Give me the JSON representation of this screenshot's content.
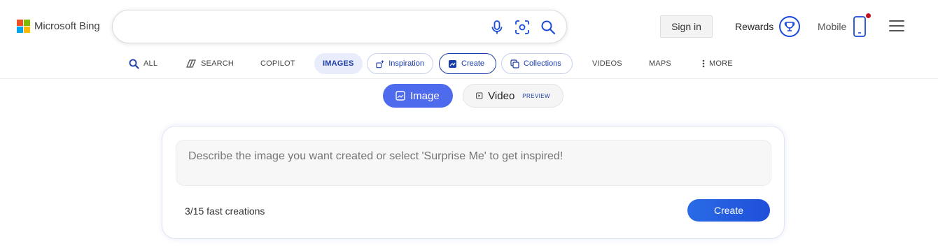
{
  "header": {
    "logo_text": "Microsoft Bing",
    "logo_colors": [
      "#f25022",
      "#7fba00",
      "#00a4ef",
      "#ffb900"
    ],
    "search": {
      "value": "",
      "placeholder": "",
      "icons": [
        "microphone-icon",
        "visual-search-icon",
        "search-icon"
      ]
    },
    "signin_label": "Sign in",
    "rewards_label": "Rewards",
    "mobile_label": "Mobile",
    "accent_color": "#1a4bd8",
    "notification_dot_color": "#c50f1f"
  },
  "scopes": {
    "all": "ALL",
    "search": "SEARCH",
    "copilot": "COPILOT",
    "images": "IMAGES",
    "inspiration": "Inspiration",
    "create": "Create",
    "collections": "Collections",
    "videos": "VIDEOS",
    "maps": "MAPS",
    "more": "MORE",
    "active": "IMAGES",
    "selected_pill": "Create"
  },
  "modes": {
    "image_label": "Image",
    "video_label": "Video",
    "video_badge": "PREVIEW",
    "active": "Image"
  },
  "creator": {
    "prompt_placeholder": "Describe the image you want created or select 'Surprise Me' to get inspired!",
    "prompt_value": "",
    "fast_creations": "3/15 fast creations",
    "create_label": "Create"
  }
}
